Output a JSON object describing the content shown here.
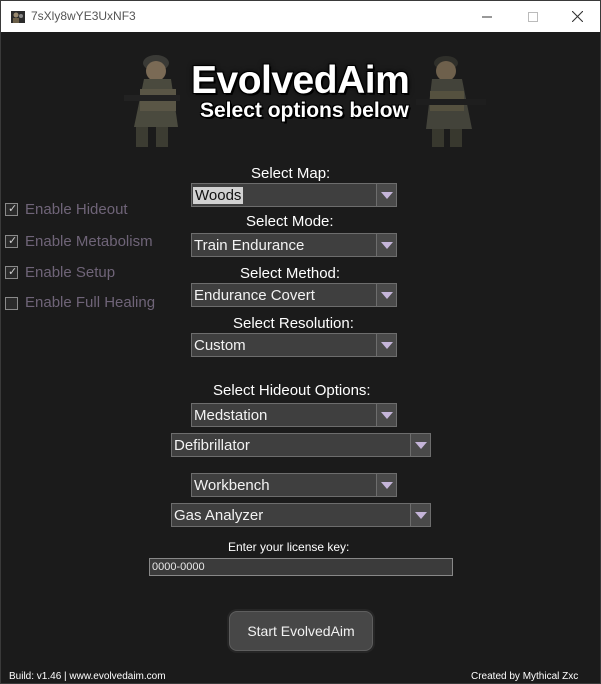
{
  "window": {
    "title": "7sXly8wYE3UxNF3"
  },
  "banner": {
    "title": "EvolvedAim",
    "subtitle": "Select options below"
  },
  "checkboxes": [
    {
      "label": "Enable Hideout",
      "checked": true
    },
    {
      "label": "Enable Metabolism",
      "checked": true
    },
    {
      "label": "Enable Setup",
      "checked": true
    },
    {
      "label": "Enable Full Healing",
      "checked": false
    }
  ],
  "map": {
    "label": "Select Map:",
    "value": "Woods"
  },
  "mode": {
    "label": "Select Mode:",
    "value": "Train Endurance"
  },
  "method": {
    "label": "Select Method:",
    "value": "Endurance Covert"
  },
  "resolution": {
    "label": "Select Resolution:",
    "value": "Custom"
  },
  "hideout": {
    "label": "Select Hideout Options:",
    "station1": "Medstation",
    "item1": "Defibrillator",
    "station2": "Workbench",
    "item2": "Gas Analyzer"
  },
  "license": {
    "label": "Enter your license key:",
    "value": "0000-0000"
  },
  "start_button": "Start EvolvedAim",
  "footer": {
    "build": "Build: v1.46 | www.evolvedaim.com",
    "credit": "Created by Mythical Zxc"
  },
  "colors": {
    "background": "#1b1b1b",
    "checkbox_label": "#6f6478",
    "dropdown": "#3f3f3f"
  }
}
